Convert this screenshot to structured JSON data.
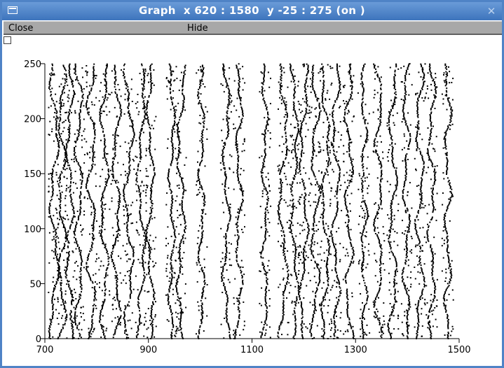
{
  "window": {
    "title": "Graph  x 620 : 1580  y -25 : 275 (on )",
    "close_glyph": "✕",
    "menu_icon": "window-menu-icon",
    "border_color": "#4f83c6"
  },
  "menubar": {
    "close_label": "Close",
    "hide_label": "Hide"
  },
  "checkbox": {
    "checked": false
  },
  "chart_data": {
    "type": "scatter",
    "title": "",
    "xlabel": "",
    "ylabel": "",
    "xlim": [
      700,
      1500
    ],
    "ylim": [
      0,
      250
    ],
    "x_ticks": [
      700,
      900,
      1100,
      1300,
      1500
    ],
    "y_ticks": [
      0,
      50,
      100,
      150,
      200,
      250
    ],
    "grid": false,
    "marker_color": "#000000",
    "series": [
      {
        "description_values": "raster of dots forming wavy vertical tracks",
        "tracks": [
          {
            "x": 718,
            "wobble": 7
          },
          {
            "x": 733,
            "wobble": 6
          },
          {
            "x": 748,
            "wobble": 5
          },
          {
            "x": 766,
            "wobble": 6
          },
          {
            "x": 790,
            "wobble": 7
          },
          {
            "x": 815,
            "wobble": 6
          },
          {
            "x": 838,
            "wobble": 6
          },
          {
            "x": 862,
            "wobble": 7
          },
          {
            "x": 886,
            "wobble": 6
          },
          {
            "x": 904,
            "wobble": 5
          },
          {
            "x": 945,
            "wobble": 4
          },
          {
            "x": 963,
            "wobble": 6
          },
          {
            "x": 1003,
            "wobble": 4
          },
          {
            "x": 1050,
            "wobble": 5
          },
          {
            "x": 1075,
            "wobble": 5
          },
          {
            "x": 1125,
            "wobble": 4
          },
          {
            "x": 1160,
            "wobble": 7
          },
          {
            "x": 1182,
            "wobble": 5
          },
          {
            "x": 1200,
            "wobble": 6
          },
          {
            "x": 1222,
            "wobble": 7
          },
          {
            "x": 1242,
            "wobble": 6
          },
          {
            "x": 1262,
            "wobble": 6
          },
          {
            "x": 1287,
            "wobble": 6
          },
          {
            "x": 1316,
            "wobble": 4
          },
          {
            "x": 1345,
            "wobble": 6
          },
          {
            "x": 1372,
            "wobble": 6
          },
          {
            "x": 1398,
            "wobble": 5
          },
          {
            "x": 1424,
            "wobble": 6
          },
          {
            "x": 1447,
            "wobble": 5
          },
          {
            "x": 1478,
            "wobble": 5
          }
        ]
      }
    ]
  }
}
